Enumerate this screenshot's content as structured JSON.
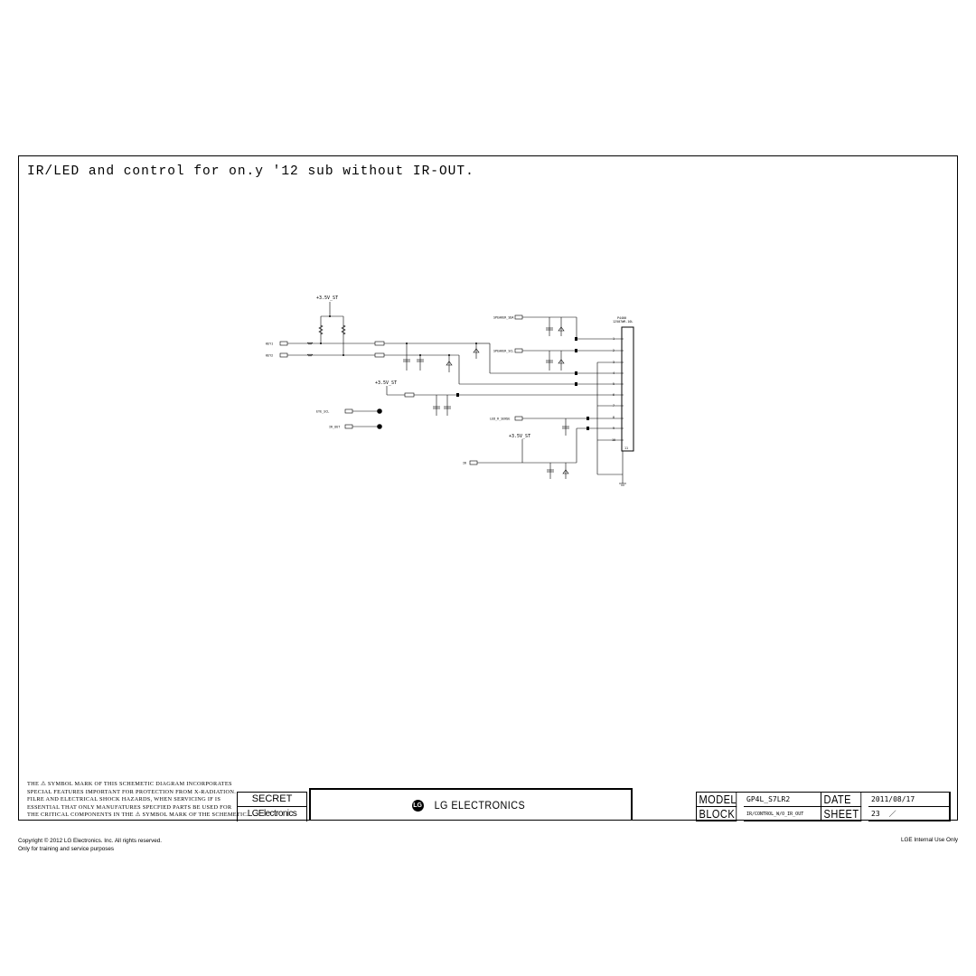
{
  "title": "IR/LED and control for on.y '12 sub without IR-OUT.",
  "schematic": {
    "power_net": "+3.5V_ST",
    "connectors_left": [
      "KEY1",
      "KEY2"
    ],
    "connectors_mid": [
      "EYE_SCL",
      "IR_OUT"
    ],
    "connectors_right_top": [
      "SPEAKER_SDA",
      "SPEAKER_SCL"
    ],
    "led_input": "LED_R_SENSE",
    "ir_input": "IR",
    "header_ref": "P4400",
    "header_part": "12507WR-10L",
    "header_pins": [
      "1",
      "2",
      "3",
      "4",
      "5",
      "6",
      "7",
      "8",
      "9",
      "10",
      "11"
    ],
    "resistors": [
      {
        "ref": "R4401",
        "value": "10K"
      },
      {
        "ref": "R4402",
        "value": "10K"
      },
      {
        "ref": "R4404",
        "value": "10K"
      },
      {
        "ref": "R4403",
        "value": "10K"
      },
      {
        "ref": "R4411",
        "value": "10K"
      },
      {
        "ref": "R4412",
        "value": "10K"
      },
      {
        "ref": "R4413",
        "value": "1.5K"
      },
      {
        "ref": "R4415",
        "value": "4.7K"
      }
    ],
    "inductors": [
      "L4401",
      "L4402",
      "L4403"
    ],
    "capacitors": [
      "C4401",
      "C4402",
      "C4403",
      "C4404",
      "C4405",
      "C4410",
      "C4411",
      "C4412"
    ],
    "diodes": [
      "ZD4401",
      "ZD4402",
      "ZD4403",
      "ZD4404",
      "ZD4405"
    ]
  },
  "footer": {
    "safety_note": [
      "THE ⚠ SYMBOL MARK OF THIS SCHEMETIC DIAGRAM INCORPORATES",
      "SPECIAL FEATURES IMPORTANT FOR PROTECTION FROM X-RADIATION.",
      "FILRE AND ELECTRICAL SHOCK HAZARDS, WHEN SERVICING IF IS",
      "ESSENTIAL THAT ONLY MANUFATURES SPECFIED PARTS BE USED FOR",
      "THE CRITICAL COMPONENTS IN THE ⚠ SYMBOL MARK OF THE SCHEMETIC."
    ],
    "secret": "SECRET",
    "lg_electronics_small": "LGElectronics",
    "logo_text": "LG ELECTRONICS",
    "model_label": "MODEL",
    "model_value": "GP4L_S7LR2",
    "date_label": "DATE",
    "date_value": "2011/08/17",
    "block_label": "BLOCK",
    "block_value": "IR/CONTROL_W/O_IR_OUT",
    "sheet_label": "SHEET",
    "sheet_value": "23",
    "copyright": "Copyright © 2012 LG Electronics. Inc. All rights reserved.",
    "training": "Only for training and service purposes",
    "internal": "LGE Internal Use Only"
  }
}
